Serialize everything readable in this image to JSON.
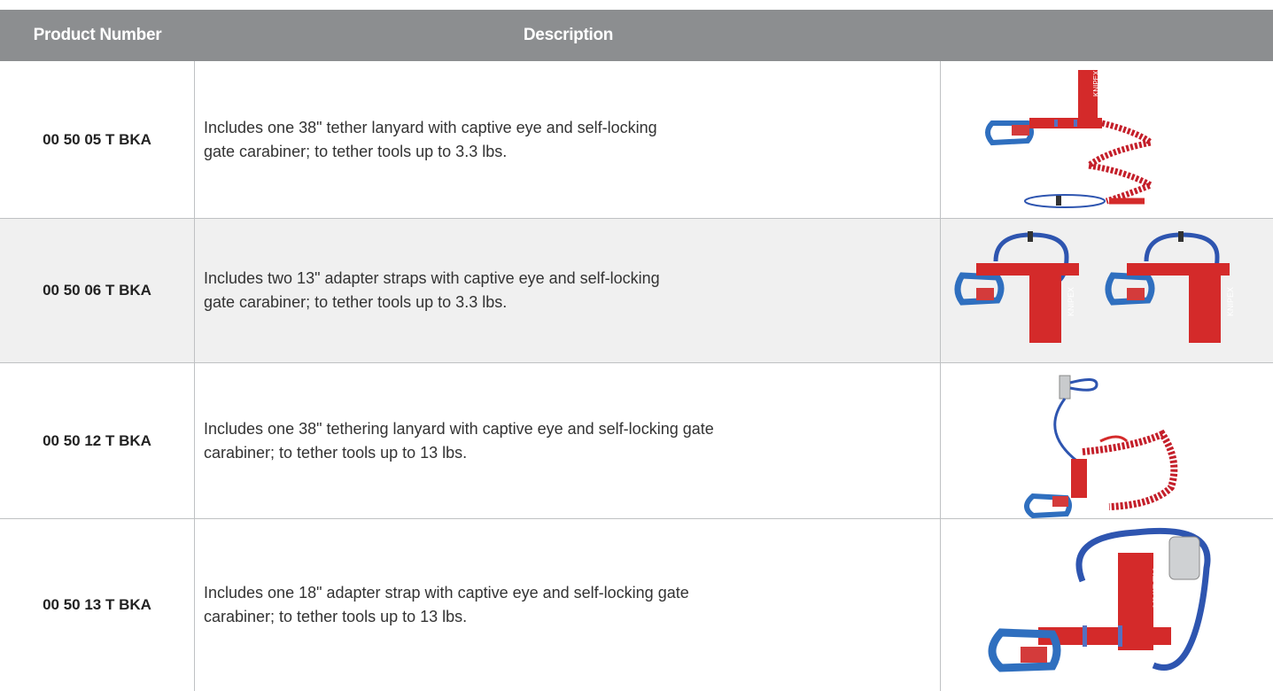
{
  "table": {
    "headers": {
      "product_number": "Product Number",
      "description": "Description"
    },
    "rows": [
      {
        "product_number": "00 50 05 T BKA",
        "description_line1": "Includes one 38\" tether lanyard with captive eye and self-locking",
        "description_line2": "gate carabiner; to tether tools up to 3.3 lbs.",
        "image_icon": "tether-lanyard-38-icon"
      },
      {
        "product_number": "00 50 06 T BKA",
        "description_line1": "Includes two 13\" adapter straps with captive eye and self-locking",
        "description_line2": "gate carabiner; to tether tools up to 3.3 lbs.",
        "image_icon": "adapter-straps-pair-icon"
      },
      {
        "product_number": "00 50 12 T BKA",
        "description_line1": "Includes one 38\" tethering lanyard with captive eye and self-locking gate",
        "description_line2": "carabiner; to tether tools up to 13 lbs.",
        "image_icon": "tethering-lanyard-13lb-icon"
      },
      {
        "product_number": "00 50 13 T BKA",
        "description_line1": "Includes one 18\" adapter strap with captive eye and self-locking gate",
        "description_line2": "carabiner; to tether tools up to 13 lbs.",
        "image_icon": "adapter-strap-18-icon"
      }
    ]
  },
  "colors": {
    "header_bg": "#8c8e90",
    "row_alt_bg": "#f0f0f0",
    "strap_red": "#d42a2a",
    "carabiner_blue": "#2f6fbf",
    "cord_blue": "#2e55b0"
  }
}
